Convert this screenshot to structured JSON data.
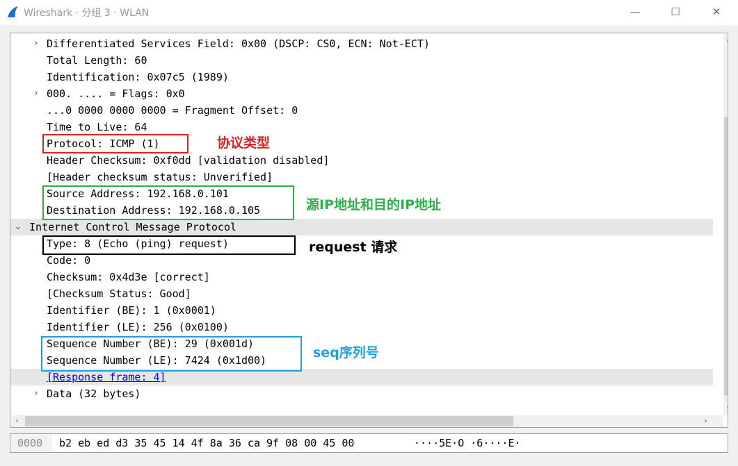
{
  "window": {
    "title": "Wireshark · 分组 3 · WLAN",
    "min_glyph": "—",
    "max_glyph": "☐",
    "close_glyph": "✕",
    "icon": "wireshark-fin-icon",
    "accent": "#1e6fd0"
  },
  "tree": {
    "rows": [
      {
        "text": "Differentiated Services Field: 0x00 (DSCP: CS0, ECN: Not-ECT)",
        "arrow": "›",
        "expandable": true
      },
      {
        "text": "Total Length: 60",
        "arrow": "",
        "expandable": false
      },
      {
        "text": "Identification: 0x07c5 (1989)",
        "arrow": "",
        "expandable": false
      },
      {
        "text": "000. .... = Flags: 0x0",
        "arrow": "›",
        "expandable": true
      },
      {
        "text": "...0 0000 0000 0000 = Fragment Offset: 0",
        "arrow": "",
        "expandable": false
      },
      {
        "text": "Time to Live: 64",
        "arrow": "",
        "expandable": false
      },
      {
        "text": "Protocol: ICMP (1)",
        "arrow": "",
        "expandable": false
      },
      {
        "text": "Header Checksum: 0xf0dd [validation disabled]",
        "arrow": "",
        "expandable": false
      },
      {
        "text": "[Header checksum status: Unverified]",
        "arrow": "",
        "expandable": false
      },
      {
        "text": "Source Address: 192.168.0.101",
        "arrow": "",
        "expandable": false
      },
      {
        "text": "Destination Address: 192.168.0.105",
        "arrow": "",
        "expandable": false
      },
      {
        "text": "Internet Control Message Protocol",
        "arrow": "⌄",
        "expandable": true
      },
      {
        "text": "Type: 8 (Echo (ping) request)",
        "arrow": "",
        "expandable": false
      },
      {
        "text": "Code: 0",
        "arrow": "",
        "expandable": false
      },
      {
        "text": "Checksum: 0x4d3e [correct]",
        "arrow": "",
        "expandable": false
      },
      {
        "text": "[Checksum Status: Good]",
        "arrow": "",
        "expandable": false
      },
      {
        "text": "Identifier (BE): 1 (0x0001)",
        "arrow": "",
        "expandable": false
      },
      {
        "text": "Identifier (LE): 256 (0x0100)",
        "arrow": "",
        "expandable": false
      },
      {
        "text": "Sequence Number (BE): 29 (0x001d)",
        "arrow": "",
        "expandable": false
      },
      {
        "text": "Sequence Number (LE): 7424 (0x1d00)",
        "arrow": "",
        "expandable": false
      },
      {
        "text": "[Response frame: 4]",
        "arrow": "",
        "expandable": false
      },
      {
        "text": "Data (32 bytes)",
        "arrow": "›",
        "expandable": true
      }
    ]
  },
  "scrollbars": {
    "up_glyph": "▲",
    "down_glyph": "▼",
    "left_glyph": "‹",
    "right_glyph": "›"
  },
  "hex": {
    "offset": "0000",
    "bytes": "b2 eb ed d3 35 45 14 4f  8a 36 ca 9f 08 00 45 00",
    "ascii": "····5E·O ·6····E·"
  },
  "annotations": {
    "protocol": "协议类型",
    "addresses": "源IP地址和目的IP地址",
    "request": "request 请求",
    "sequence": "seq序列号",
    "colors": {
      "red": "#e02020",
      "green": "#2db04a",
      "black": "#000000",
      "blue": "#1ea0e0"
    }
  }
}
